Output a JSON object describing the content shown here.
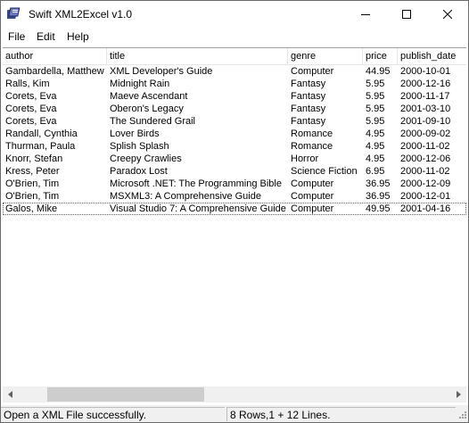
{
  "window": {
    "title": "Swift XML2Excel v1.0",
    "controls": {
      "minimize_icon": "minimize-icon",
      "maximize_icon": "maximize-icon",
      "close_icon": "close-icon"
    }
  },
  "menu": {
    "items": [
      "File",
      "Edit",
      "Help"
    ]
  },
  "table": {
    "columns": [
      "author",
      "title",
      "genre",
      "price",
      "publish_date"
    ],
    "rows": [
      [
        "Gambardella, Matthew",
        "XML Developer's Guide",
        "Computer",
        "44.95",
        "2000-10-01"
      ],
      [
        "Ralls, Kim",
        "Midnight Rain",
        "Fantasy",
        "5.95",
        "2000-12-16"
      ],
      [
        "Corets, Eva",
        "Maeve Ascendant",
        "Fantasy",
        "5.95",
        "2000-11-17"
      ],
      [
        "Corets, Eva",
        "Oberon's Legacy",
        "Fantasy",
        "5.95",
        "2001-03-10"
      ],
      [
        "Corets, Eva",
        "The Sundered Grail",
        "Fantasy",
        "5.95",
        "2001-09-10"
      ],
      [
        "Randall, Cynthia",
        "Lover Birds",
        "Romance",
        "4.95",
        "2000-09-02"
      ],
      [
        "Thurman, Paula",
        "Splish Splash",
        "Romance",
        "4.95",
        "2000-11-02"
      ],
      [
        "Knorr, Stefan",
        "Creepy Crawlies",
        "Horror",
        "4.95",
        "2000-12-06"
      ],
      [
        "Kress, Peter",
        "Paradox Lost",
        "Science Fiction",
        "6.95",
        "2000-11-02"
      ],
      [
        "O'Brien, Tim",
        "Microsoft .NET: The Programming Bible",
        "Computer",
        "36.95",
        "2000-12-09"
      ],
      [
        "O'Brien, Tim",
        "MSXML3: A Comprehensive Guide",
        "Computer",
        "36.95",
        "2000-12-01"
      ],
      [
        "Galos, Mike",
        "Visual Studio 7: A Comprehensive Guide",
        "Computer",
        "49.95",
        "2001-04-16"
      ]
    ],
    "focused_row": 11
  },
  "scrollbar": {
    "left_icon": "arrow-left-icon",
    "right_icon": "arrow-right-icon"
  },
  "status": {
    "message": "Open a XML File successfully.",
    "summary": "8 Rows,1 + 12 Lines."
  },
  "colors": {
    "header_divider": "#e5e5e5",
    "status_bg": "#f0f0f0",
    "scroll_thumb": "#cdcdcd"
  }
}
